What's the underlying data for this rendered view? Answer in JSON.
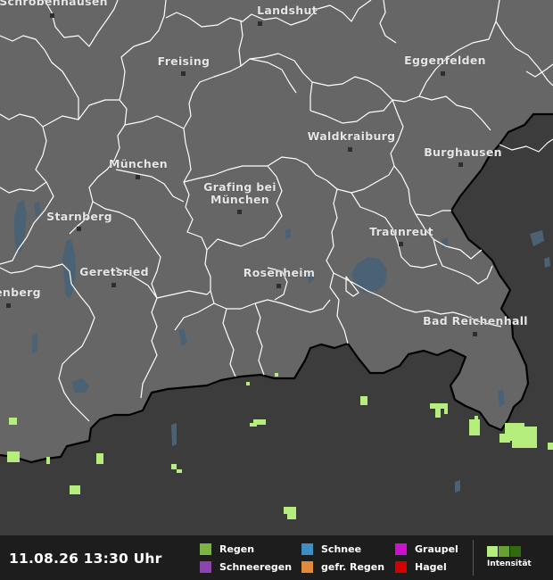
{
  "map": {
    "colors": {
      "foreign_area": "#3c3c3c",
      "region_area": "#666666",
      "district_border": "#ffffff",
      "national_border": "#000000",
      "lake": "#4b6275",
      "rain": "#b6ee7e"
    },
    "cities": [
      {
        "name": "Schrobenhausen"
      },
      {
        "name": "Landshut"
      },
      {
        "name": "Freising"
      },
      {
        "name": "Eggenfelden"
      },
      {
        "name": "Waldkraiburg"
      },
      {
        "name": "Burghausen"
      },
      {
        "name": "München"
      },
      {
        "name": "Grafing bei"
      },
      {
        "name": "München"
      },
      {
        "name": "Starnberg"
      },
      {
        "name": "Traunreut"
      },
      {
        "name": "Geretsried"
      },
      {
        "name": "Rosenheim"
      },
      {
        "name": "Bad Reichenhall"
      },
      {
        "name": "enberg"
      }
    ]
  },
  "footer": {
    "timestamp": "11.08.26 13:30 Uhr",
    "legend": [
      {
        "label": "Regen",
        "color": "#7cb342"
      },
      {
        "label": "Schneeregen",
        "color": "#8e44ad"
      },
      {
        "label": "Schnee",
        "color": "#3d8ec4"
      },
      {
        "label": "gefr. Regen",
        "color": "#e08a3a"
      },
      {
        "label": "Graupel",
        "color": "#cc10cc"
      },
      {
        "label": "Hagel",
        "color": "#d40000"
      }
    ],
    "intensity_colors": [
      "#b6ee7e",
      "#6aa032",
      "#2f6a10"
    ],
    "intensity_label": "Intensität"
  }
}
